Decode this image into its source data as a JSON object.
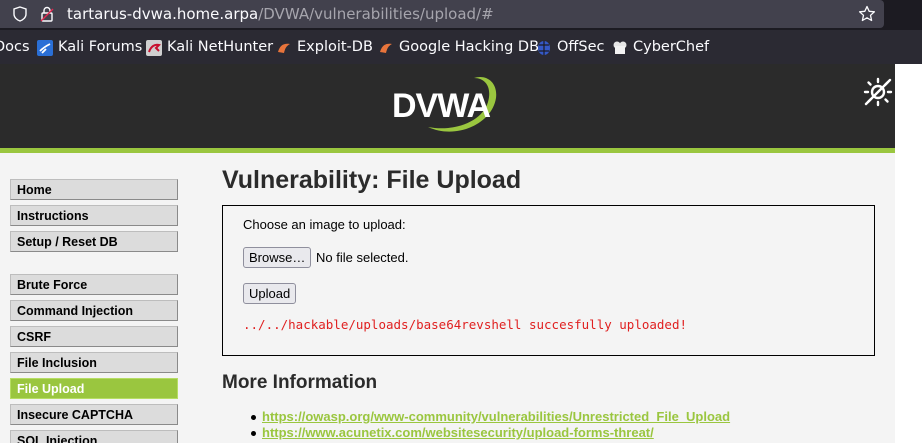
{
  "browser": {
    "url_host": "tartarus-dvwa.home.arpa",
    "url_path": "/DVWA/vulnerabilities/upload/#",
    "bookmarks": [
      "Docs",
      "Kali Forums",
      "Kali NetHunter",
      "Exploit-DB",
      "Google Hacking DB",
      "OffSec",
      "CyberChef"
    ]
  },
  "header": {
    "logo_text": "DVWA"
  },
  "menu": {
    "items": [
      "Home",
      "Instructions",
      "Setup / Reset DB",
      "Brute Force",
      "Command Injection",
      "CSRF",
      "File Inclusion",
      "File Upload",
      "Insecure CAPTCHA",
      "SQL Injection"
    ],
    "active": "File Upload"
  },
  "main": {
    "title": "Vulnerability: File Upload",
    "upload_prompt": "Choose an image to upload:",
    "browse_label": "Browse…",
    "file_status": "No file selected.",
    "upload_label": "Upload",
    "result_message": "../../hackable/uploads/base64revshell succesfully uploaded!"
  },
  "more_info": {
    "title": "More Information",
    "links": [
      "https://owasp.org/www-community/vulnerabilities/Unrestricted_File_Upload",
      "https://www.acunetix.com/websitesecurity/upload-forms-threat/"
    ]
  },
  "colors": {
    "accent": "#9ac63f",
    "header": "#2b2b2b",
    "error": "#e02020"
  }
}
